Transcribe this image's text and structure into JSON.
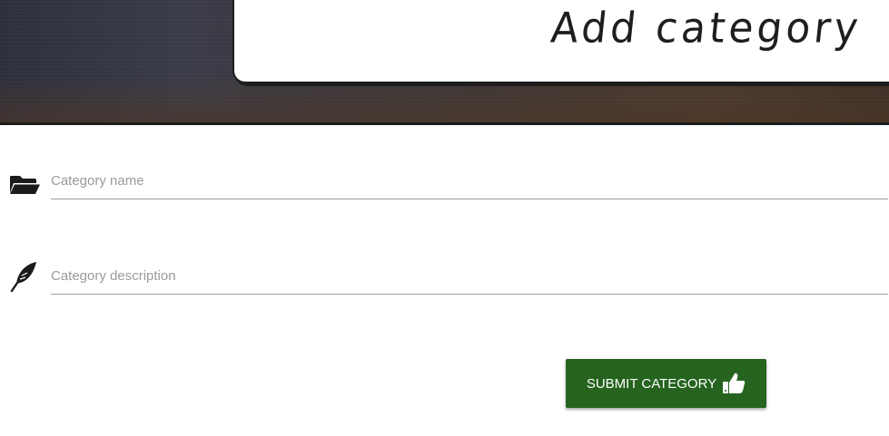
{
  "header": {
    "title": "Add category"
  },
  "form": {
    "name_field": {
      "placeholder": "Category name",
      "value": "",
      "icon": "folder-open-icon"
    },
    "description_field": {
      "placeholder": "Category description",
      "value": "",
      "icon": "feather-icon"
    },
    "submit": {
      "label": "SUBMIT CATEGORY",
      "icon": "thumbs-up-icon",
      "color": "#25631f"
    }
  }
}
